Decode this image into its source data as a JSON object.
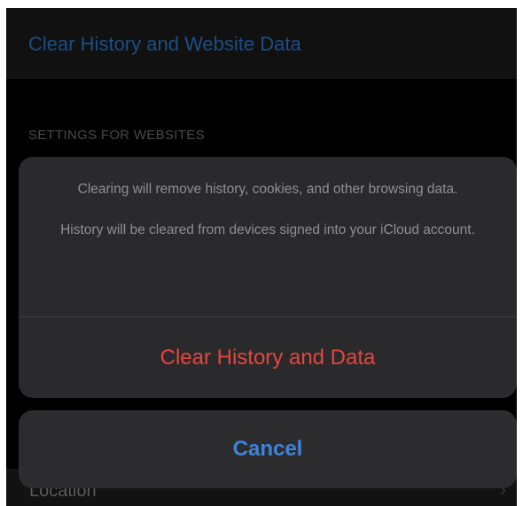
{
  "background": {
    "top_link": "Clear History and Website Data",
    "section_header": "SETTINGS FOR WEBSITES",
    "bottom_row_label": "Location",
    "bottom_row_chevron": "›"
  },
  "action_sheet": {
    "message_line1": "Clearing will remove history, cookies, and other browsing data.",
    "message_line2": "History will be cleared from devices signed into your iCloud account.",
    "destructive_label": "Clear History and Data",
    "cancel_label": "Cancel"
  },
  "colors": {
    "destructive": "#e5453d",
    "cancel": "#3d84dc",
    "sheet_background": "#2a2a2c"
  }
}
